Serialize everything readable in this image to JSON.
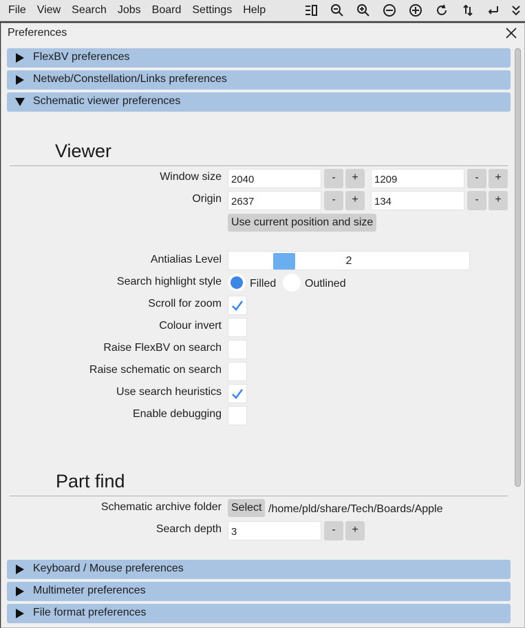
{
  "menubar": {
    "items": [
      "File",
      "View",
      "Search",
      "Jobs",
      "Board",
      "Settings",
      "Help"
    ],
    "toolbar_icons": [
      "list-view-icon",
      "zoom-out-magnifier-icon",
      "zoom-in-magnifier-icon",
      "zoom-out-circle-icon",
      "zoom-in-circle-icon",
      "rotate-icon",
      "flip-vertical-icon",
      "flip-horizontal-icon",
      "overflow-menu-icon"
    ]
  },
  "window": {
    "title": "Preferences",
    "close_icon": "close-icon"
  },
  "sections": {
    "flexbv": "FlexBV preferences",
    "netweb": "Netweb/Constellation/Links preferences",
    "schematic": "Schematic viewer preferences",
    "keyboard": "Keyboard / Mouse preferences",
    "multimeter": "Multimeter preferences",
    "fileformat": "File format preferences"
  },
  "viewer": {
    "heading": "Viewer",
    "window_size_label": "Window size",
    "window_width": "2040",
    "window_height": "1209",
    "origin_label": "Origin",
    "origin_x": "2637",
    "origin_y": "134",
    "minus": "-",
    "plus": "+",
    "use_current_label": "Use current position and size",
    "antialias_label": "Antialias Level",
    "antialias_value": "2",
    "antialias_fraction": 0.2,
    "highlight_label": "Search highlight style",
    "highlight_options": [
      "Filled",
      "Outlined"
    ],
    "highlight_selected": "Filled",
    "scroll_zoom_label": "Scroll for zoom",
    "scroll_zoom_checked": true,
    "colour_invert_label": "Colour invert",
    "colour_invert_checked": false,
    "raise_flexbv_label": "Raise FlexBV on search",
    "raise_flexbv_checked": false,
    "raise_schematic_label": "Raise schematic on search",
    "raise_schematic_checked": false,
    "heuristics_label": "Use search heuristics",
    "heuristics_checked": true,
    "debug_label": "Enable debugging",
    "debug_checked": false
  },
  "partfind": {
    "heading": "Part find",
    "archive_label": "Schematic archive folder",
    "select_label": "Select",
    "archive_path": "/home/pld/share/Tech/Boards/Apple",
    "depth_label": "Search depth",
    "depth_value": "3"
  },
  "colors": {
    "accent": "#3d86e6",
    "section_header": "#a9c4e3",
    "slider_handle": "#6aaef0"
  }
}
